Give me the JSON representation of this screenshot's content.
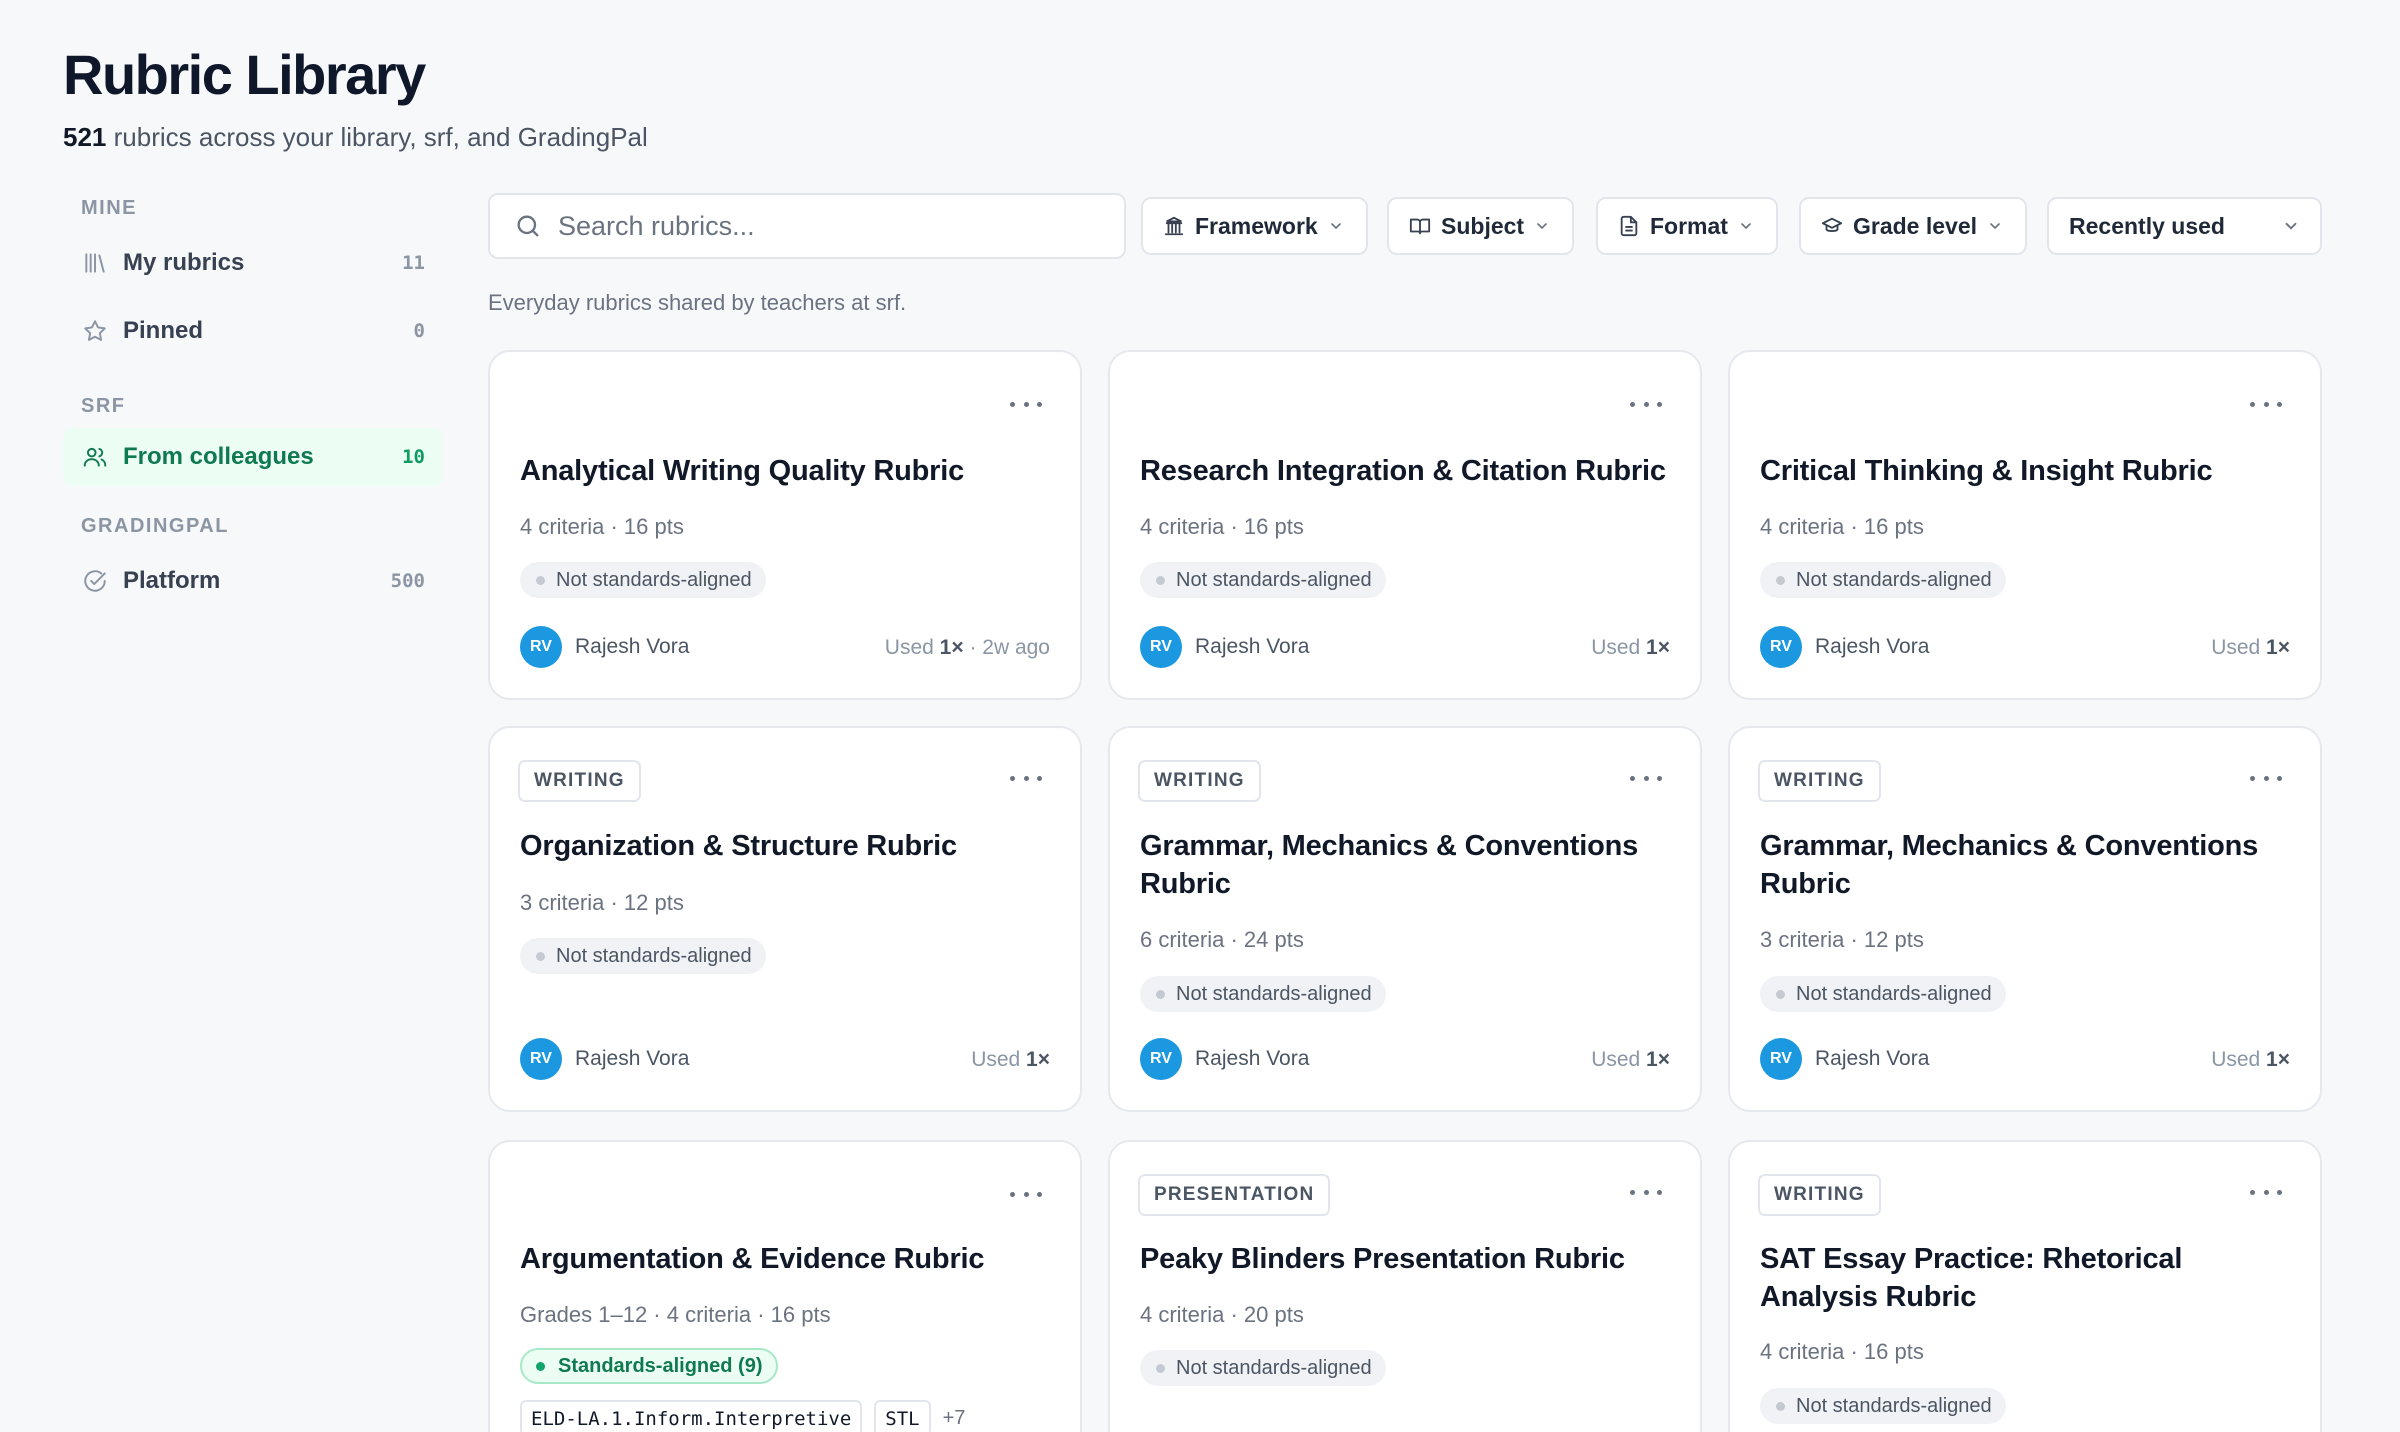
{
  "header": {
    "title": "Rubric Library",
    "count": "521",
    "subtitle": "rubrics across your library, srf, and GradingPal"
  },
  "sidebar": {
    "sections": [
      {
        "label": "MINE",
        "items": [
          {
            "label": "My rubrics",
            "count": "11",
            "icon": "library-icon"
          },
          {
            "label": "Pinned",
            "count": "0",
            "icon": "star-icon"
          }
        ]
      },
      {
        "label": "SRF",
        "items": [
          {
            "label": "From colleagues",
            "count": "10",
            "icon": "users-icon",
            "active": true
          }
        ]
      },
      {
        "label": "GRADINGPAL",
        "items": [
          {
            "label": "Platform",
            "count": "500",
            "icon": "check-circle-icon"
          }
        ]
      }
    ]
  },
  "toolbar": {
    "search_placeholder": "Search rubrics...",
    "filters": {
      "framework": "Framework",
      "subject": "Subject",
      "format": "Format",
      "grade_level": "Grade level"
    },
    "sort": "Recently used"
  },
  "intro": "Everyday rubrics shared by teachers at srf.",
  "colors": {
    "accent_green": "#0f7a4f",
    "active_bg": "#ecfdf3",
    "avatar_blue": "#1c98e0"
  },
  "cards": [
    {
      "tag": "",
      "title": "Analytical Writing Quality Rubric",
      "meta": "4 criteria · 16 pts",
      "badge": "Not standards-aligned",
      "author": "Rajesh Vora",
      "initials": "RV",
      "usage_prefix": "Used ",
      "usage_count": "1×",
      "usage_suffix": " · 2w ago"
    },
    {
      "tag": "",
      "title": "Research Integration & Citation Rubric",
      "meta": "4 criteria · 16 pts",
      "badge": "Not standards-aligned",
      "author": "Rajesh Vora",
      "initials": "RV",
      "usage_prefix": "Used ",
      "usage_count": "1×",
      "usage_suffix": ""
    },
    {
      "tag": "",
      "title": "Critical Thinking & Insight Rubric",
      "meta": "4 criteria · 16 pts",
      "badge": "Not standards-aligned",
      "author": "Rajesh Vora",
      "initials": "RV",
      "usage_prefix": "Used ",
      "usage_count": "1×",
      "usage_suffix": ""
    },
    {
      "tag": "WRITING",
      "title": "Organization & Structure Rubric",
      "meta": "3 criteria · 12 pts",
      "badge": "Not standards-aligned",
      "author": "Rajesh Vora",
      "initials": "RV",
      "usage_prefix": "Used ",
      "usage_count": "1×",
      "usage_suffix": ""
    },
    {
      "tag": "WRITING",
      "title": "Grammar, Mechanics & Conventions Rubric",
      "meta": "6 criteria · 24 pts",
      "badge": "Not standards-aligned",
      "author": "Rajesh Vora",
      "initials": "RV",
      "usage_prefix": "Used ",
      "usage_count": "1×",
      "usage_suffix": ""
    },
    {
      "tag": "WRITING",
      "title": "Grammar, Mechanics & Conventions Rubric",
      "meta": "3 criteria · 12 pts",
      "badge": "Not standards-aligned",
      "author": "Rajesh Vora",
      "initials": "RV",
      "usage_prefix": "Used ",
      "usage_count": "1×",
      "usage_suffix": ""
    },
    {
      "tag": "",
      "title": "Argumentation & Evidence Rubric",
      "meta": "Grades 1–12 · 4 criteria · 16 pts",
      "badge": "Standards-aligned (9)",
      "codes": [
        "ELD-LA.1.Inform.Interpretive",
        "STL"
      ],
      "codes_more": "+7"
    },
    {
      "tag": "PRESENTATION",
      "title": "Peaky Blinders Presentation Rubric",
      "meta": "4 criteria · 20 pts",
      "badge": "Not standards-aligned"
    },
    {
      "tag": "WRITING",
      "title": "SAT Essay Practice: Rhetorical Analysis Rubric",
      "meta": "4 criteria · 16 pts",
      "badge": "Not standards-aligned"
    }
  ]
}
